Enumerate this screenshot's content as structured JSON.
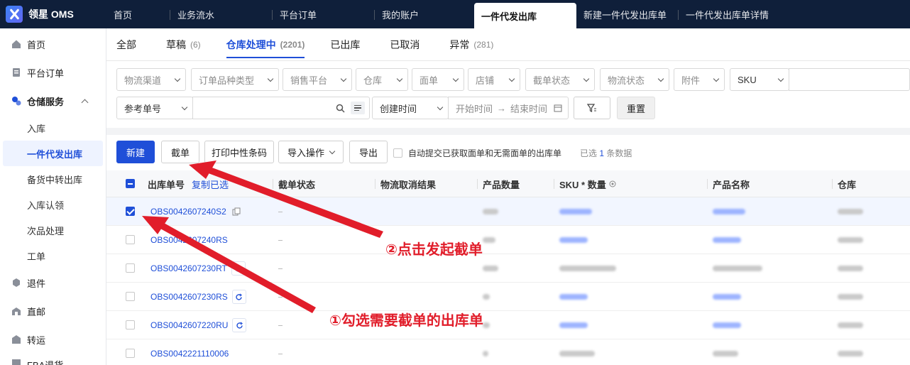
{
  "app": {
    "name": "领星 OMS"
  },
  "top_tabs": [
    "首页",
    "业务流水",
    "平台订单",
    "我的账户",
    "一件代发出库",
    "新建一件代发出库单",
    "一件代发出库单详情"
  ],
  "sidebar": {
    "items": [
      {
        "label": "首页",
        "icon": "home-icon"
      },
      {
        "label": "平台订单",
        "icon": "order-icon"
      },
      {
        "label": "仓储服务",
        "icon": "warehouse-icon",
        "subs": [
          "入库",
          "一件代发出库",
          "备货中转出库",
          "入库认领",
          "次品处理",
          "工单"
        ]
      },
      {
        "label": "退件",
        "icon": "return-icon"
      },
      {
        "label": "直邮",
        "icon": "mail-icon"
      },
      {
        "label": "转运",
        "icon": "transfer-icon"
      },
      {
        "label": "FBA退货",
        "icon": "fba-icon"
      }
    ]
  },
  "status_tabs": [
    {
      "label": "全部",
      "count": ""
    },
    {
      "label": "草稿",
      "count": "(6)"
    },
    {
      "label": "仓库处理中",
      "count": "(2201)"
    },
    {
      "label": "已出库",
      "count": ""
    },
    {
      "label": "已取消",
      "count": ""
    },
    {
      "label": "异常",
      "count": "(281)"
    }
  ],
  "filters": {
    "row1": [
      "物流渠道",
      "订单品种类型",
      "销售平台",
      "仓库",
      "面单",
      "店铺",
      "截单状态",
      "物流状态",
      "附件",
      "SKU"
    ],
    "ref_select": "参考单号",
    "date_select": "创建时间",
    "date_start": "开始时间",
    "date_arrow": "→",
    "date_end": "结束时间",
    "reset": "重置"
  },
  "actions": {
    "new": "新建",
    "intercept": "截单",
    "print": "打印中性条码",
    "import": "导入操作",
    "export": "导出",
    "auto_submit": "自动提交已获取面单和无需面单的出库单",
    "selected_prefix": "已选",
    "selected_count": "1",
    "selected_suffix": "条数据"
  },
  "table": {
    "headers": [
      "出库单号",
      "截单状态",
      "物流取消结果",
      "产品数量",
      "SKU * 数量",
      "产品名称",
      "仓库"
    ],
    "copy_selected": "复制已选",
    "rows": [
      {
        "id": "OBS0042607240S2",
        "checked": true
      },
      {
        "id": "OBS0042607240RS",
        "checked": false
      },
      {
        "id": "OBS0042607230RT",
        "checked": false
      },
      {
        "id": "OBS0042607230RS",
        "checked": false
      },
      {
        "id": "OBS0042607220RU",
        "checked": false
      },
      {
        "id": "OBS0042221110006",
        "checked": false
      }
    ]
  },
  "annotations": {
    "step1": "①勾选需要截单的出库单",
    "step2": "②点击发起截单"
  },
  "colors": {
    "primary": "#1f4fd8",
    "topbar": "#0f1f3a",
    "annotation": "#e11d2a"
  }
}
